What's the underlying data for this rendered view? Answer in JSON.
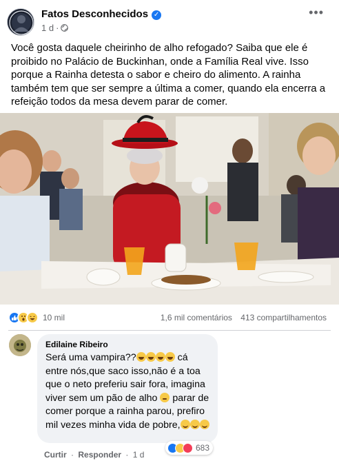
{
  "post": {
    "page_name": "Fatos Desconhecidos",
    "time": "1 d",
    "separator": "·",
    "text": "Você gosta daquele cheirinho de alho refogado? Saiba que ele é proibido no Palácio de Buckinhan, onde a Família Real vive. Isso porque a Rainha detesta o sabor e cheiro do alimento. A rainha também tem que ser sempre a última a comer, quando ela encerra a refeição todos da mesa devem parar de comer."
  },
  "icons": {
    "more": "more-options-icon",
    "verified": "verified-badge-icon",
    "audience": "globe-icon",
    "reactions": [
      "like-icon",
      "wow-icon",
      "haha-icon"
    ],
    "comment_reactions": [
      "like-icon",
      "haha-icon",
      "love-icon"
    ]
  },
  "stats": {
    "reactions_count": "10 mil",
    "comments": "1,6 mil comentários",
    "shares": "413 compartilhamentos"
  },
  "comment": {
    "author": "Edilaine Ribeiro",
    "text_parts": {
      "p1": "Será uma vampira??",
      "p2": " cá entre nós,que saco isso,não é a toa que o neto preferiu sair fora, imagina viver sem um pão de alho ",
      "p3": " parar de comer porque a rainha parou, prefiro mil vezes minha vida de pobre,"
    },
    "reactions_count": "683",
    "actions": {
      "like": "Curtir",
      "reply": "Responder",
      "time": "1 d",
      "dot": "·"
    }
  },
  "colors": {
    "accent": "#1877f2",
    "like_blue": "#1877f2",
    "love_red": "#f33e58",
    "haha_yellow": "#f7c948",
    "secondary_text": "#65676b",
    "bubble_bg": "#f0f2f5"
  }
}
